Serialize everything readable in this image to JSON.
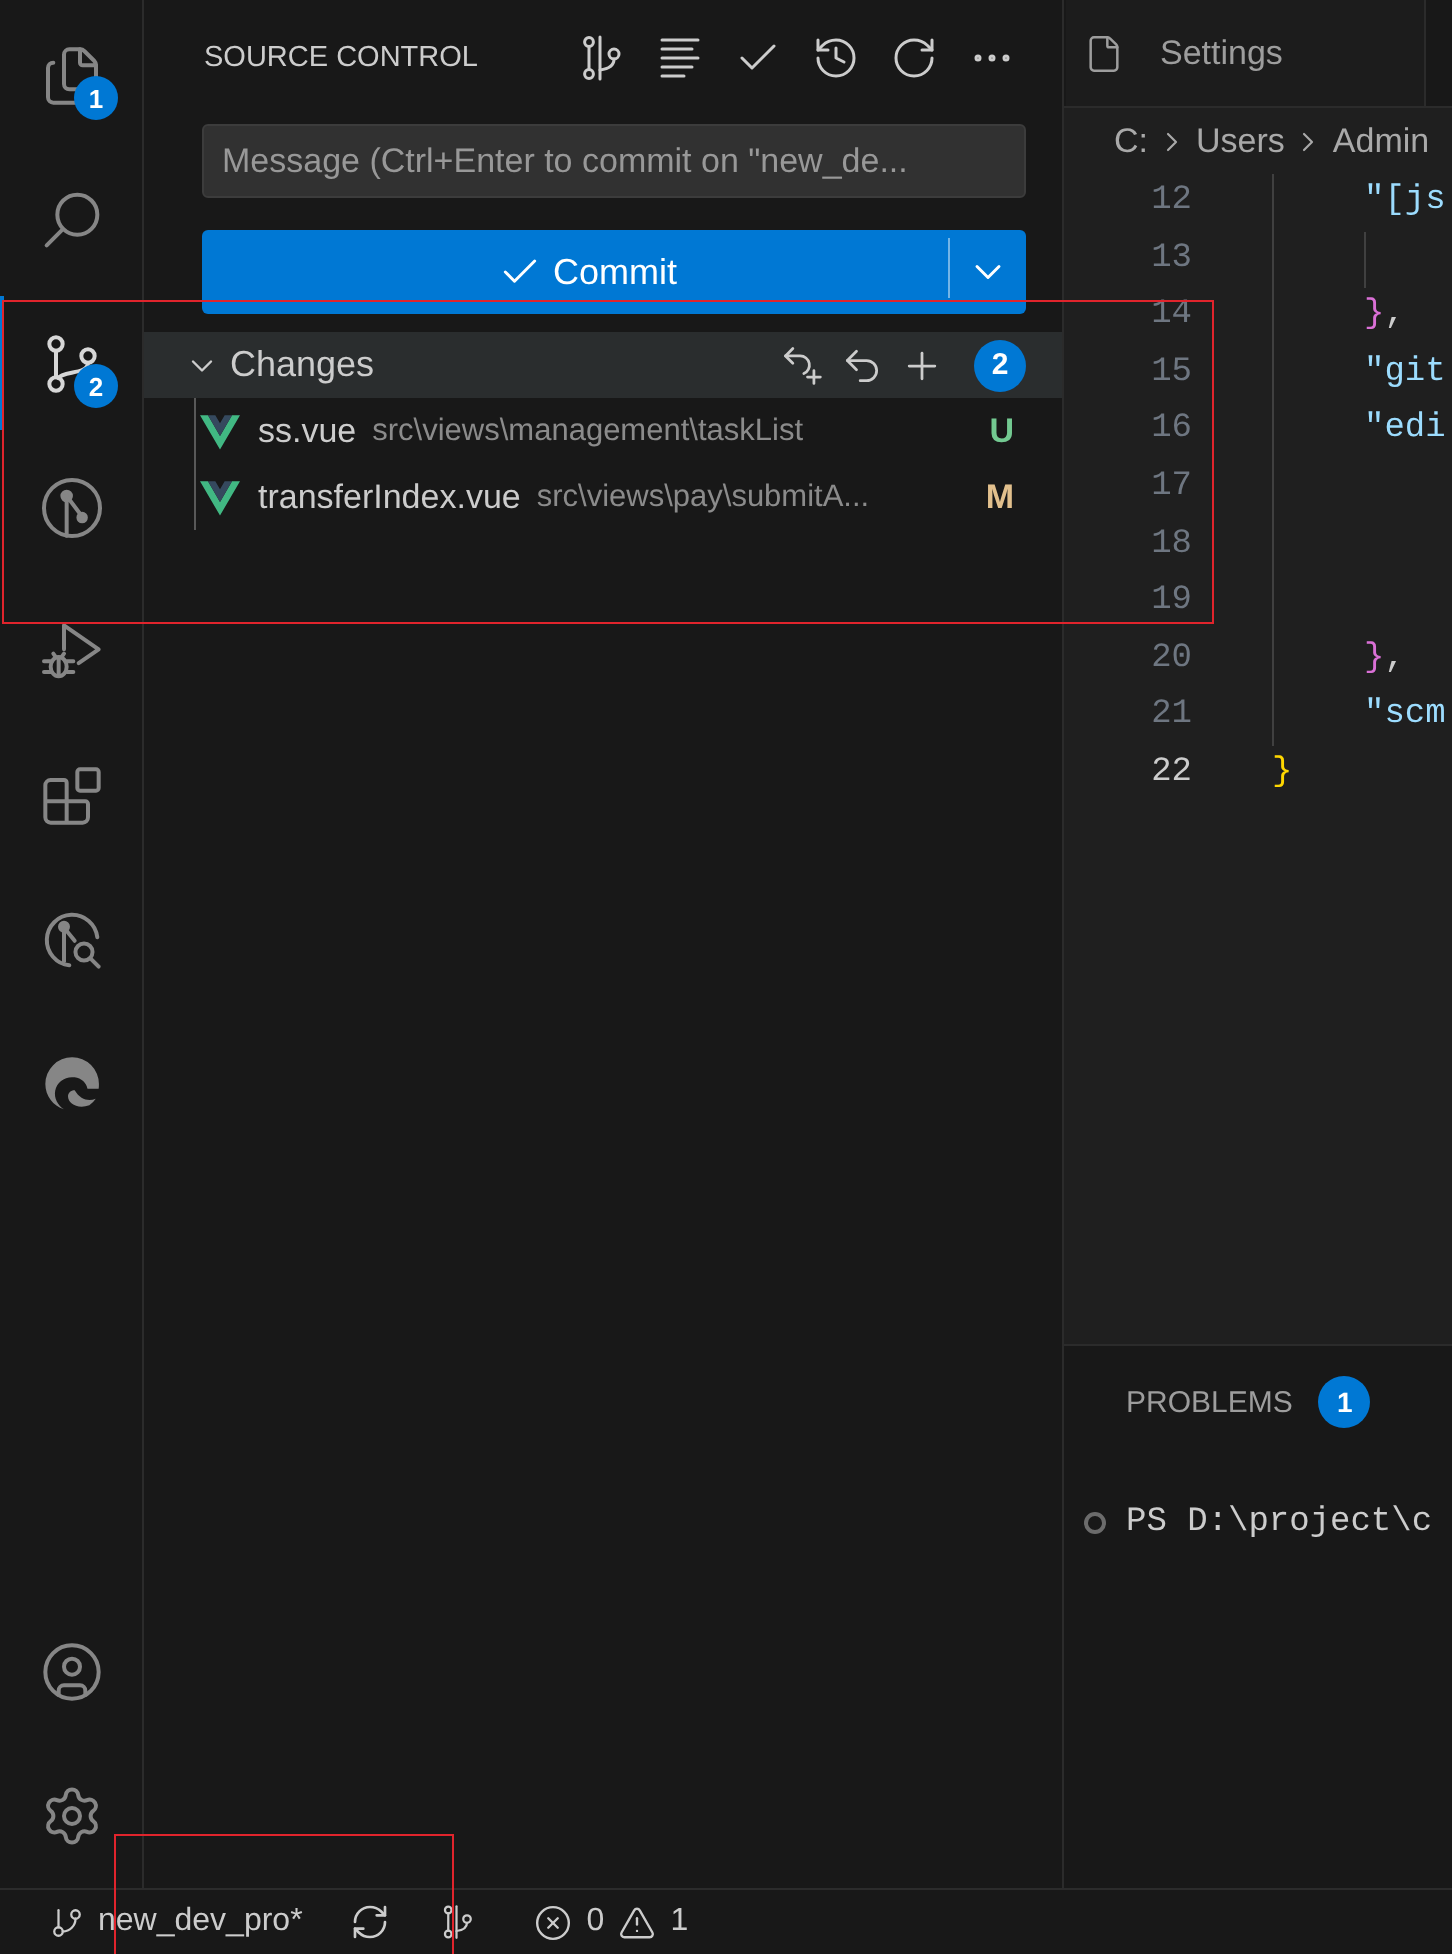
{
  "activity_bar": {
    "items": [
      {
        "kind": "explorer",
        "badge": "1",
        "selected": false
      },
      {
        "kind": "search",
        "selected": false
      },
      {
        "kind": "source_control",
        "badge": "2",
        "selected": true
      },
      {
        "kind": "git_graph",
        "selected": false
      },
      {
        "kind": "run_debug",
        "selected": false
      },
      {
        "kind": "extensions",
        "selected": false
      },
      {
        "kind": "git_search",
        "selected": false
      },
      {
        "kind": "edge",
        "selected": false
      }
    ],
    "bottom_items": [
      {
        "kind": "account"
      },
      {
        "kind": "settings"
      }
    ]
  },
  "sidebar": {
    "title": "SOURCE CONTROL",
    "message": {
      "placeholder": "Message (Ctrl+Enter to commit on \"new_de..."
    },
    "commit_button": {
      "label": "Commit"
    },
    "changes": {
      "title": "Changes",
      "expanded": true,
      "count": "2",
      "files": [
        {
          "name": "ss.vue",
          "path": "src\\views\\management\\taskList",
          "status": "U",
          "color": "#73c991"
        },
        {
          "name": "transferIndex.vue",
          "path": "src\\views\\pay\\submitA...",
          "status": "M",
          "color": "#e2c08d"
        }
      ]
    }
  },
  "editor": {
    "tabs": [
      {
        "label": "Settings",
        "selected": false
      }
    ],
    "breadcrumbs": [
      "C:",
      "Users",
      "Admin"
    ],
    "lines": [
      {
        "number": "12",
        "kind": "member",
        "active": false,
        "tokens": [
          {
            "text": "\"[js",
            "kind": "key"
          }
        ]
      },
      {
        "number": "13",
        "kind": "nested",
        "active": false
      },
      {
        "number": "14",
        "kind": "member",
        "active": false,
        "tokens": [
          {
            "text": "}",
            "kind": "bracket"
          },
          {
            "text": ",",
            "kind": "punct"
          }
        ]
      },
      {
        "number": "15",
        "kind": "member",
        "active": false,
        "tokens": [
          {
            "text": "\"git",
            "kind": "key"
          }
        ]
      },
      {
        "number": "16",
        "kind": "member",
        "active": false,
        "tokens": [
          {
            "text": "\"edi",
            "kind": "key"
          }
        ]
      },
      {
        "number": "17",
        "kind": "member",
        "active": false
      },
      {
        "number": "18",
        "kind": "member",
        "active": false
      },
      {
        "number": "19",
        "kind": "member",
        "active": false
      },
      {
        "number": "20",
        "kind": "member",
        "active": false,
        "tokens": [
          {
            "text": "}",
            "kind": "bracket"
          },
          {
            "text": ",",
            "kind": "punct"
          }
        ]
      },
      {
        "number": "21",
        "kind": "member",
        "active": false,
        "tokens": [
          {
            "text": "\"scm",
            "kind": "key"
          }
        ]
      },
      {
        "number": "22",
        "kind": "root",
        "active": true,
        "tokens": [
          {
            "text": "}",
            "kind": "root_bracket"
          }
        ]
      }
    ]
  },
  "panel": {
    "tabs": [
      {
        "label": "PROBLEMS",
        "badge": "1",
        "selected": false
      }
    ],
    "terminal": [
      "PS D:\\project\\c"
    ]
  },
  "status_bar": {
    "branch": "new_dev_pro*",
    "errors": "0",
    "warnings": "1"
  }
}
